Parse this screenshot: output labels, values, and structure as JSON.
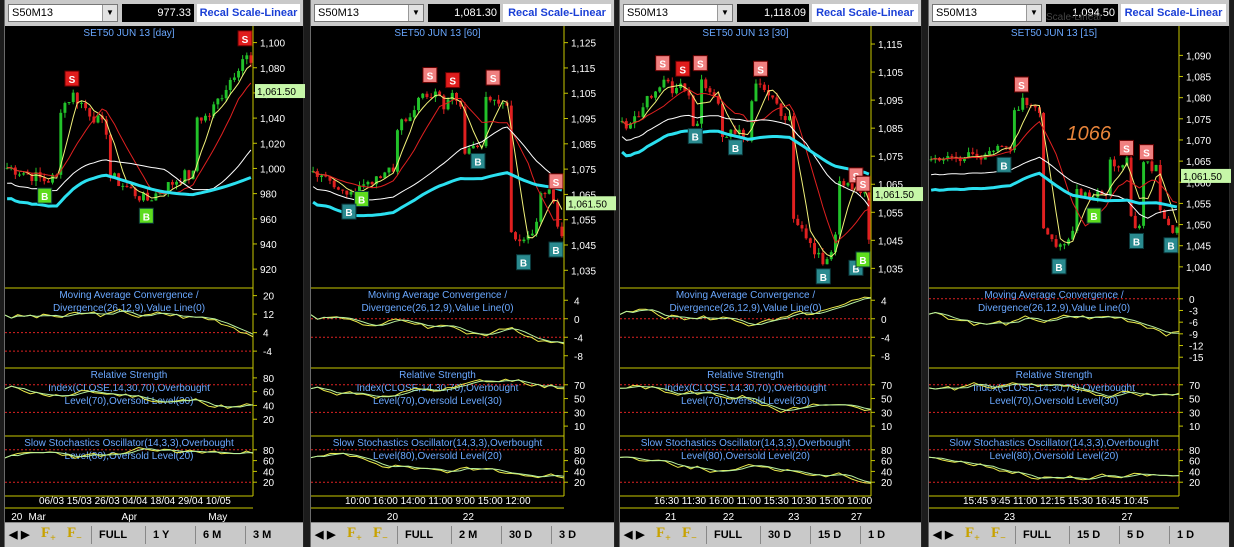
{
  "panels": [
    {
      "symbol": "S50M13",
      "price": "977.33",
      "recal_label": "Recal Scale-Linear",
      "chart_title": "SET50 JUN 13   [day]",
      "last_price": "1,061.50",
      "annotation": "",
      "ghost_text": "",
      "time_labels": "06/03 15/03 26/03 04/04 18/04 29/04 10/05",
      "date_labels": [
        {
          "t": "20",
          "frac": 0.025
        },
        {
          "t": "Mar",
          "frac": 0.095
        },
        {
          "t": "Apr",
          "frac": 0.47
        },
        {
          "t": "May",
          "frac": 0.82
        }
      ],
      "price_axis": {
        "min": 905,
        "max": 1110,
        "ticks": [
          "1,100",
          "1,080",
          "1,060",
          "1,040",
          "1,020",
          "1,000",
          "980",
          "960",
          "940",
          "920"
        ],
        "tick_values": [
          1100,
          1080,
          1060,
          1040,
          1020,
          1000,
          980,
          960,
          940,
          920
        ]
      },
      "macd": {
        "title": [
          "Moving Average Convergence /",
          "Divergence(26,12,9),Value Line(0)"
        ],
        "min": -10,
        "max": 22,
        "ticks": [
          "20",
          "12",
          "4",
          "-4"
        ],
        "tick_values": [
          20,
          12,
          4,
          -4
        ],
        "ref_lines": [
          4,
          -4
        ]
      },
      "rsi": {
        "title": [
          "Relative Strength",
          "Index(CLOSE,14,30,70),Overbought",
          "Level(70),Oversold Level(30)"
        ],
        "ticks": [
          "80",
          "60",
          "40",
          "20"
        ],
        "tick_values": [
          80,
          60,
          40,
          20
        ]
      },
      "stoch": {
        "title": [
          "Slow Stochastics Oscillator(14,3,3),Overbought",
          "Level(80),Oversold Level(20)"
        ],
        "ticks": [
          "80",
          "60",
          "40",
          "20"
        ],
        "tick_values": [
          80,
          60,
          40,
          20
        ]
      },
      "signals": [
        {
          "type": "S",
          "x": 0.27,
          "price": 1071,
          "color": "#e01c1c"
        },
        {
          "type": "S",
          "x": 0.975,
          "price": 1103,
          "color": "#e01c1c"
        },
        {
          "type": "B",
          "x": 0.16,
          "price": 978,
          "color": "#5ddc1e"
        },
        {
          "type": "B",
          "x": 0.57,
          "price": 962,
          "color": "#5ddc1e"
        }
      ],
      "bottom_bar": [
        "FULL",
        "1 Y",
        "6 M",
        "3 M"
      ],
      "selected": "3 M"
    },
    {
      "symbol": "S50M13",
      "price": "1,081.30",
      "recal_label": "Recal Scale-Linear",
      "chart_title": "SET50 JUN 13   [60]",
      "last_price": "1,061.50",
      "annotation": "",
      "ghost_text": "",
      "time_labels": "10:00 16:00 14:00 11:00 9:00 15:00 12:00",
      "date_labels": [
        {
          "t": "20",
          "frac": 0.3
        },
        {
          "t": "22",
          "frac": 0.6
        }
      ],
      "price_axis": {
        "min": 1028,
        "max": 1130,
        "ticks": [
          "1,125",
          "1,115",
          "1,105",
          "1,095",
          "1,085",
          "1,075",
          "1,065",
          "1,055",
          "1,045",
          "1,035"
        ],
        "tick_values": [
          1125,
          1115,
          1105,
          1095,
          1085,
          1075,
          1065,
          1055,
          1045,
          1035
        ]
      },
      "macd": {
        "title": [
          "Moving Average Convergence /",
          "Divergence(26,12,9),Value Line(0)"
        ],
        "min": -10,
        "max": 6,
        "ticks": [
          "4",
          "0",
          "-4",
          "-8"
        ],
        "tick_values": [
          4,
          0,
          -4,
          -8
        ],
        "ref_lines": [
          0,
          -4
        ]
      },
      "rsi": {
        "title": [
          "Relative Strength",
          "Index(CLOSE,14,30,70),Overbought",
          "Level(70),Oversold Level(30)"
        ],
        "ticks": [
          "70",
          "50",
          "30",
          "10"
        ],
        "tick_values": [
          70,
          50,
          30,
          10
        ]
      },
      "stoch": {
        "title": [
          "Slow Stochastics Oscillator(14,3,3),Overbought",
          "Level(80),Oversold Level(20)"
        ],
        "ticks": [
          "80",
          "60",
          "40",
          "20"
        ],
        "tick_values": [
          80,
          60,
          40,
          20
        ]
      },
      "signals": [
        {
          "type": "S",
          "x": 0.47,
          "price": 1112,
          "color": "#f08080"
        },
        {
          "type": "S",
          "x": 0.56,
          "price": 1110,
          "color": "#e01c1c"
        },
        {
          "type": "S",
          "x": 0.72,
          "price": 1111,
          "color": "#f08080"
        },
        {
          "type": "S",
          "x": 0.97,
          "price": 1070,
          "color": "#f08080"
        },
        {
          "type": "B",
          "x": 0.2,
          "price": 1063,
          "color": "#5ddc1e"
        },
        {
          "type": "B",
          "x": 0.15,
          "price": 1058,
          "color": "#2a8a8f"
        },
        {
          "type": "B",
          "x": 0.66,
          "price": 1078,
          "color": "#2a8a8f"
        },
        {
          "type": "B",
          "x": 0.84,
          "price": 1038,
          "color": "#2a8a8f"
        },
        {
          "type": "B",
          "x": 0.995,
          "price": 1043,
          "color": "#2a8a8f"
        }
      ],
      "bottom_bar": [
        "FULL",
        "2 M",
        "30 D",
        "3 D"
      ],
      "selected": "3 D"
    },
    {
      "symbol": "S50M13",
      "price": "1,118.09",
      "recal_label": "Recal Scale-Linear",
      "chart_title": "SET50 JUN 13   [30]",
      "last_price": "1,061.50",
      "annotation": "",
      "ghost_text": "",
      "time_labels": "16:30 11:30 16:00 11:00 15:30 10:30 15:00 10:00",
      "date_labels": [
        {
          "t": "21",
          "frac": 0.18
        },
        {
          "t": "22",
          "frac": 0.41
        },
        {
          "t": "23",
          "frac": 0.67
        },
        {
          "t": "27",
          "frac": 0.92
        }
      ],
      "price_axis": {
        "min": 1028,
        "max": 1120,
        "ticks": [
          "1,115",
          "1,105",
          "1,095",
          "1,085",
          "1,075",
          "1,065",
          "1,055",
          "1,045",
          "1,035"
        ],
        "tick_values": [
          1115,
          1105,
          1095,
          1085,
          1075,
          1065,
          1055,
          1045,
          1035
        ]
      },
      "macd": {
        "title": [
          "Moving Average Convergence /",
          "Divergence(26,12,9),Value Line(0)"
        ],
        "min": -10,
        "max": 6,
        "ticks": [
          "4",
          "0",
          "-4",
          "-8"
        ],
        "tick_values": [
          4,
          0,
          -4,
          -8
        ],
        "ref_lines": [
          0,
          -4
        ]
      },
      "rsi": {
        "title": [
          "Relative Strength",
          "Index(CLOSE,14,30,70),Overbought",
          "Level(70),Oversold Level(30)"
        ],
        "ticks": [
          "70",
          "50",
          "30",
          "10"
        ],
        "tick_values": [
          70,
          50,
          30,
          10
        ]
      },
      "stoch": {
        "title": [
          "Slow Stochastics Oscillator(14,3,3),Overbought",
          "Level(80),Oversold Level(20)"
        ],
        "ticks": [
          "80",
          "60",
          "40",
          "20"
        ],
        "tick_values": [
          80,
          60,
          40,
          20
        ]
      },
      "signals": [
        {
          "type": "S",
          "x": 0.17,
          "price": 1108,
          "color": "#f08080"
        },
        {
          "type": "S",
          "x": 0.25,
          "price": 1106,
          "color": "#e01c1c"
        },
        {
          "type": "S",
          "x": 0.32,
          "price": 1108,
          "color": "#f08080"
        },
        {
          "type": "S",
          "x": 0.56,
          "price": 1106,
          "color": "#f08080"
        },
        {
          "type": "S",
          "x": 0.94,
          "price": 1068,
          "color": "#f08080"
        },
        {
          "type": "S",
          "x": 0.99,
          "price": 1065,
          "color": "#f08080"
        },
        {
          "type": "B",
          "x": 0.3,
          "price": 1082,
          "color": "#2a8a8f"
        },
        {
          "type": "B",
          "x": 0.46,
          "price": 1078,
          "color": "#2a8a8f"
        },
        {
          "type": "B",
          "x": 0.81,
          "price": 1032,
          "color": "#2a8a8f"
        },
        {
          "type": "B",
          "x": 0.94,
          "price": 1035,
          "color": "#2a8a8f"
        },
        {
          "type": "B",
          "x": 1.0,
          "price": 1038,
          "color": "#5ddc1e"
        }
      ],
      "bottom_bar": [
        "FULL",
        "30 D",
        "15 D",
        "1 D"
      ],
      "selected": "1 D"
    },
    {
      "symbol": "S50M13",
      "price": "1,094.50",
      "recal_label": "Recal Scale-Linear",
      "chart_title": "SET50 JUN 13   [15]",
      "last_price": "1,061.50",
      "annotation": "1066",
      "ghost_text": "Scale-Linear",
      "time_labels": "15:45 9:45 11:00 12:15 15:30 16:45 10:45",
      "date_labels": [
        {
          "t": "23",
          "frac": 0.3
        },
        {
          "t": "27",
          "frac": 0.77
        }
      ],
      "price_axis": {
        "min": 1035,
        "max": 1096,
        "ticks": [
          "1,090",
          "1,085",
          "1,080",
          "1,075",
          "1,070",
          "1,065",
          "1,060",
          "1,055",
          "1,050",
          "1,045",
          "1,040"
        ],
        "tick_values": [
          1090,
          1085,
          1080,
          1075,
          1070,
          1065,
          1060,
          1055,
          1050,
          1045,
          1040
        ]
      },
      "macd": {
        "title": [
          "Moving Average Convergence /",
          "Divergence(26,12,9),Value Line(0)"
        ],
        "min": -17,
        "max": 2,
        "ticks": [
          "0",
          "-3",
          "-6",
          "-9",
          "-12",
          "-15"
        ],
        "tick_values": [
          0,
          -3,
          -6,
          -9,
          -12,
          -15
        ],
        "ref_lines": [
          0
        ]
      },
      "rsi": {
        "title": [
          "Relative Strength",
          "Index(CLOSE,14,30,70),Overbought",
          "Level(70),Oversold Level(30)"
        ],
        "ticks": [
          "70",
          "50",
          "30",
          "10"
        ],
        "tick_values": [
          70,
          50,
          30,
          10
        ]
      },
      "stoch": {
        "title": [
          "Slow Stochastics Oscillator(14,3,3),Overbought",
          "Level(80),Oversold Level(20)"
        ],
        "ticks": [
          "80",
          "60",
          "40",
          "20"
        ],
        "tick_values": [
          80,
          60,
          40,
          20
        ]
      },
      "signals": [
        {
          "type": "S",
          "x": 0.37,
          "price": 1083,
          "color": "#f08080"
        },
        {
          "type": "S",
          "x": 0.79,
          "price": 1068,
          "color": "#f08080"
        },
        {
          "type": "S",
          "x": 0.87,
          "price": 1067,
          "color": "#f08080"
        },
        {
          "type": "B",
          "x": 0.3,
          "price": 1064,
          "color": "#2a8a8f"
        },
        {
          "type": "B",
          "x": 0.66,
          "price": 1052,
          "color": "#5ddc1e"
        },
        {
          "type": "B",
          "x": 0.52,
          "price": 1040,
          "color": "#2a8a8f"
        },
        {
          "type": "B",
          "x": 0.83,
          "price": 1046,
          "color": "#2a8a8f"
        },
        {
          "type": "B",
          "x": 0.99,
          "price": 1045,
          "color": "#2a8a8f"
        }
      ],
      "bottom_bar": [
        "FULL",
        "15 D",
        "5 D",
        "1 D"
      ],
      "selected": "1 D"
    }
  ]
}
